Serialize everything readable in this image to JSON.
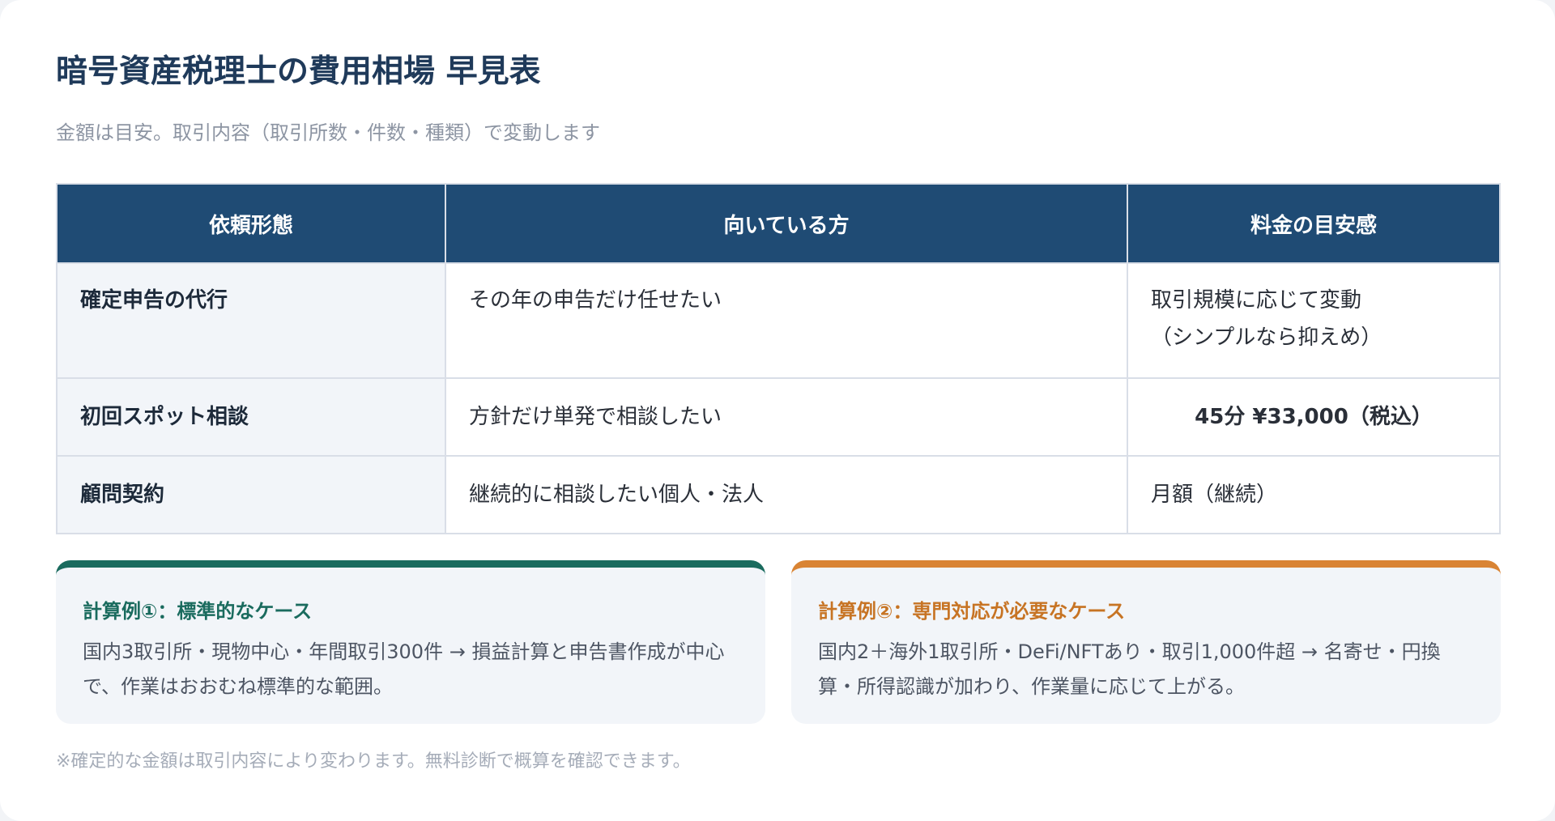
{
  "title": "暗号資産税理士の費用相場 早見表",
  "subtitle": "金額は目安。取引内容（取引所数・件数・種類）で変動します",
  "table": {
    "headers": [
      "依頼形態",
      "向いている方",
      "料金の目安感"
    ],
    "rows": [
      {
        "form": "確定申告の代行",
        "target": "その年の申告だけ任せたい",
        "price_line1": "取引規模に応じて変動",
        "price_line2": "（シンプルなら抑えめ）"
      },
      {
        "form": "初回スポット相談",
        "target": "方針だけ単発で相談したい",
        "price": "45分 ¥33,000（税込）"
      },
      {
        "form": "顧問契約",
        "target": "継続的に相談したい個人・法人",
        "price": "月額（継続）"
      }
    ]
  },
  "examples": [
    {
      "title": "計算例①：標準的なケース",
      "body": "国内3取引所・現物中心・年間取引300件 → 損益計算と申告書作成が中心で、作業はおおむね標準的な範囲。",
      "accent": "#1a6b5e"
    },
    {
      "title": "計算例②：専門対応が必要なケース",
      "body": "国内2＋海外1取引所・DeFi/NFTあり・取引1,000件超 → 名寄せ・円換算・所得認識が加わり、作業量に応じて上がる。",
      "accent": "#d98434"
    }
  ],
  "footnote": "※確定的な金額は取引内容により変わります。無料診断で概算を確認できます。",
  "colors": {
    "header_bg": "#1f4b74",
    "title_text": "#1f3a5a",
    "highlight_green": "#1a6b5e",
    "accent_orange": "#d98434"
  }
}
